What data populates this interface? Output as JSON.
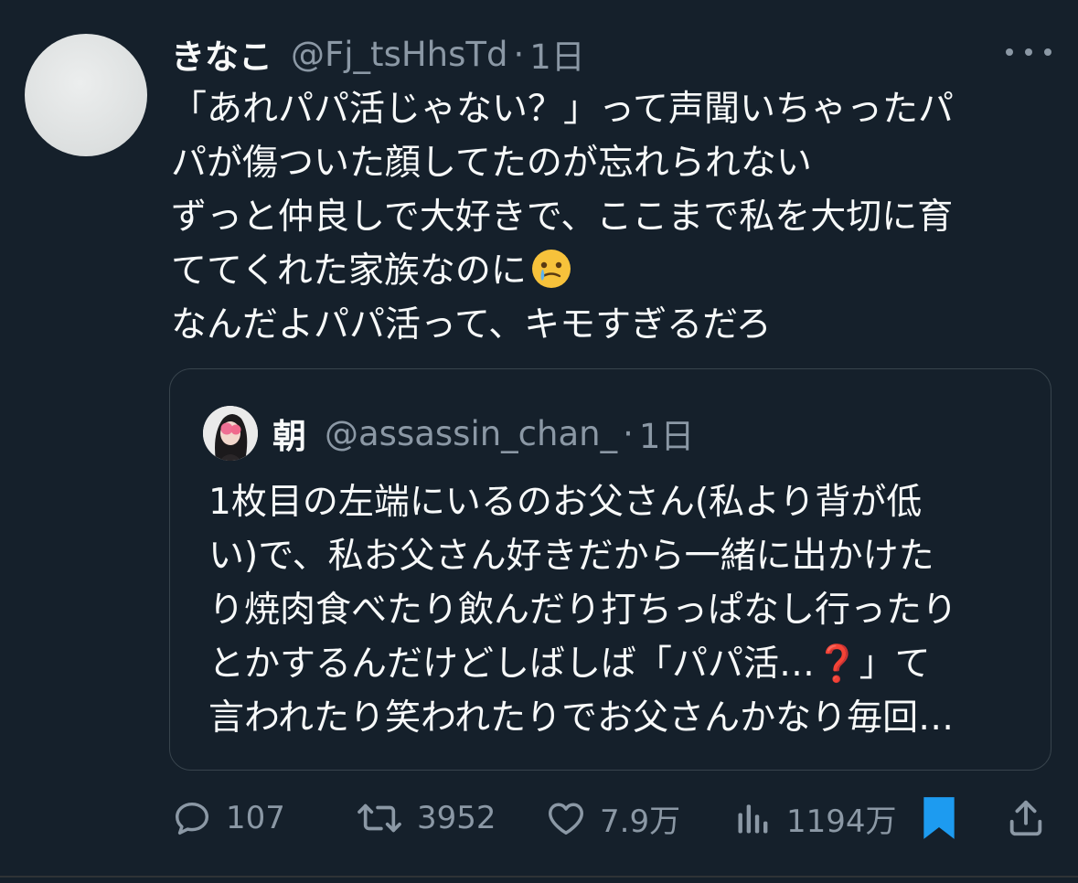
{
  "tweet": {
    "display_name": "きなこ",
    "handle": "@Fj_tsHhsTd",
    "separator": "·",
    "time": "1日",
    "lines": [
      "「あれパパ活じゃない？」って声聞いちゃったパ",
      "パが傷ついた顔してたのが忘れられない",
      "ずっと仲良しで大好きで、ここまで私を大切に育",
      "ててくれた家族なのに",
      "なんだよパパ活って、キモすぎるだろ"
    ],
    "emoji_icon": "face-holding-back-tears-icon"
  },
  "quote": {
    "display_name": "朝",
    "handle": "@assassin_chan_",
    "separator": "·",
    "time": "1日",
    "lines": [
      "1枚目の左端にいるのお父さん(私より背が低",
      "い)で、私お父さん好きだから一緒に出かけた",
      "り焼肉食べたり飲んだり打ちっぱなし行ったり",
      "とかするんだけどしばしば「パパ活…",
      "」て",
      "言われたり笑われたりでお父さんかなり毎回…"
    ],
    "emoji_symbol": "❓"
  },
  "actions": {
    "replies": "107",
    "retweets": "3952",
    "likes": "7.9万",
    "views": "1194万"
  },
  "colors": {
    "background": "#15202b",
    "text": "#f7f9f9",
    "secondary": "#8b98a5",
    "border": "#38444d",
    "bookmark": "#1d9bf0"
  }
}
